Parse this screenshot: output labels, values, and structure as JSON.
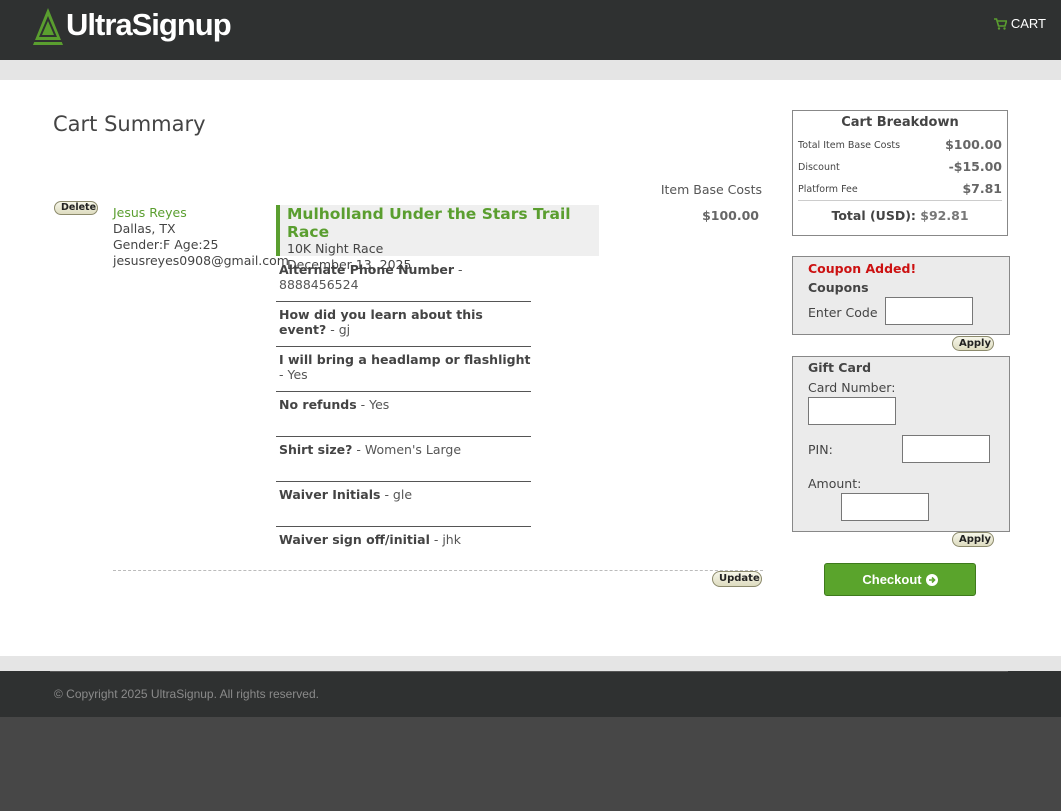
{
  "header": {
    "brand": "UltraSignup",
    "cart_label": "CART"
  },
  "page": {
    "title": "Cart Summary",
    "column_header": "Item Base Costs"
  },
  "item": {
    "delete_label": "Delete",
    "participant": {
      "name": "Jesus Reyes",
      "location": "Dallas, TX",
      "gender_age": "Gender:F Age:25",
      "email": "jesusreyes0908@gmail.com"
    },
    "race": {
      "title": "Mulholland Under the Stars Trail Race",
      "distance": "10K Night Race",
      "date": "December 13, 2025"
    },
    "price": "$100.00",
    "questions": [
      {
        "q": "Alternate Phone Number",
        "a": " - 8888456524"
      },
      {
        "q": "How did you learn about this event?",
        "a": " - gj"
      },
      {
        "q": "I will bring a headlamp or flashlight",
        "a": " - Yes"
      },
      {
        "q": "No refunds",
        "a": " - Yes"
      },
      {
        "q": "Shirt size?",
        "a": " - Women's Large"
      },
      {
        "q": "Waiver Initials",
        "a": " - gle"
      },
      {
        "q": "Waiver sign off/initial",
        "a": " - jhk"
      }
    ],
    "update_label": "Update"
  },
  "breakdown": {
    "title": "Cart Breakdown",
    "rows": [
      {
        "label": "Total Item Base Costs",
        "value": "$100.00"
      },
      {
        "label": "Discount",
        "value": "-$15.00"
      },
      {
        "label": "Platform Fee",
        "value": "$7.81"
      }
    ],
    "total_label": "Total (USD):",
    "total_value": "$92.81"
  },
  "coupon": {
    "status": "Coupon Added!",
    "title": "Coupons",
    "label": "Enter Code",
    "value": "",
    "apply_label": "Apply"
  },
  "gift_card": {
    "title": "Gift Card",
    "card_label": "Card Number:",
    "pin_label": "PIN:",
    "amount_label": "Amount:",
    "apply_label": "Apply"
  },
  "checkout_label": "Checkout",
  "footer": {
    "copyright": "© Copyright 2025 UltraSignup. All rights reserved."
  },
  "colors": {
    "brand_green": "#5a9e2f",
    "header_bg": "#2f3131",
    "alert_red": "#cc1111"
  }
}
